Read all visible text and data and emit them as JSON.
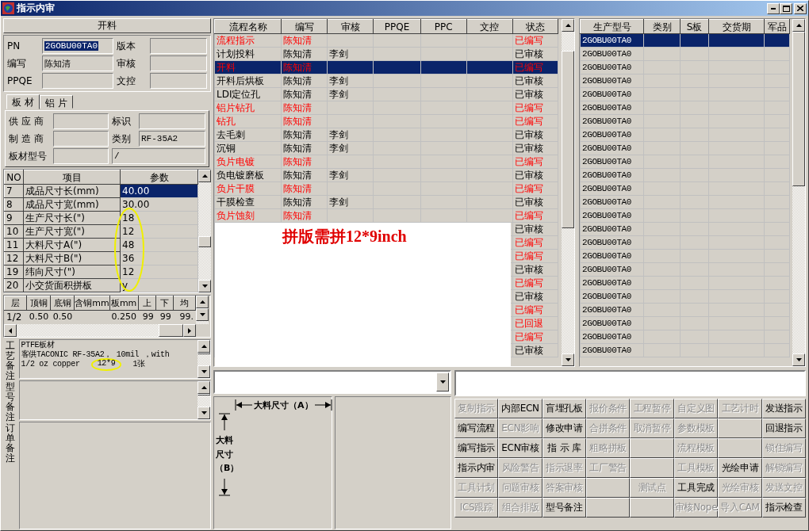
{
  "window": {
    "title": "指示内审"
  },
  "left_panel": {
    "header": "开料",
    "fields": [
      {
        "label": "PN",
        "value": "2GOBU00TA0",
        "highlighted": true
      },
      {
        "label": "版本"
      },
      {
        "label": "编写",
        "value": "陈知清",
        "highlighted": false
      },
      {
        "label": "审核"
      },
      {
        "label": "PPQE"
      },
      {
        "label": "文控"
      }
    ],
    "tabs": [
      {
        "label": "板 材",
        "selected": true
      },
      {
        "label": "铝 片",
        "selected": false
      }
    ],
    "material_fields": [
      {
        "label": "供 应 商"
      },
      {
        "label": "标识"
      },
      {
        "label": "制 造 商"
      },
      {
        "label": "类别",
        "value": "RF-35A2"
      },
      {
        "label": "板材型号"
      },
      {
        "value": "/"
      }
    ],
    "params": {
      "columns": [
        "NO",
        "项目",
        "参数"
      ],
      "rows": [
        {
          "no": "7",
          "item": "成品尺寸长(mm)",
          "value": "40.00",
          "selected": true
        },
        {
          "no": "8",
          "item": "成品尺寸宽(mm)",
          "value": "30.00",
          "selected": false
        },
        {
          "no": "9",
          "item": "生产尺寸长(\")",
          "value": "18",
          "selected": false
        },
        {
          "no": "10",
          "item": "生产尺寸宽(\")",
          "value": "12",
          "selected": false
        },
        {
          "no": "11",
          "item": "大料尺寸A(\")",
          "value": "48",
          "selected": false
        },
        {
          "no": "12",
          "item": "大料尺寸B(\")",
          "value": "36",
          "selected": false
        },
        {
          "no": "19",
          "item": "纬向尺寸(\")",
          "value": "12",
          "selected": false
        },
        {
          "no": "20",
          "item": "小交货面积拼板",
          "value": "y",
          "selected": false
        }
      ]
    },
    "layers": {
      "columns": [
        "层",
        "顶铜",
        "底铜",
        "含铜mm",
        "板mm",
        "上",
        "下",
        "均"
      ],
      "rows": [
        [
          "1/2",
          "0.50",
          "0.50",
          null,
          "0.250",
          "99",
          "99",
          "99."
        ]
      ]
    },
    "notes": [
      {
        "label": "工艺备注",
        "lines": [
          {
            "parts": [
              {
                "text": "PTFE板材",
                "circled": false
              }
            ]
          },
          {
            "parts": [
              {
                "text": "客供TACONIC RF-35A2， 10mil ，with",
                "circled": false
              }
            ]
          },
          {
            "parts": [
              {
                "text": "1/2 oz copper",
                "circled": false
              },
              {
                "text": "12*9",
                "circled": true
              },
              {
                "text": "1张",
                "circled": false
              }
            ]
          }
        ]
      },
      {
        "label": "型号备注"
      },
      {
        "label": "订单备注"
      }
    ]
  },
  "process_table": {
    "columns": [
      "流程名称",
      "编写",
      "审核",
      "PPQE",
      "PPC",
      "文控",
      "状态"
    ],
    "rows": [
      {
        "name": "流程指示",
        "writer": "陈知清",
        "status": "已编写",
        "flagged": true,
        "selected": false
      },
      {
        "name": "计划投料",
        "writer": "陈知清",
        "reviewer": "李剑",
        "status": "已审核",
        "flagged": false,
        "selected": false
      },
      {
        "name": "开料",
        "writer": "陈知清",
        "status": "已编写",
        "flagged": true,
        "selected": true
      },
      {
        "name": "开料后烘板",
        "writer": "陈知清",
        "reviewer": "李剑",
        "status": "已审核",
        "flagged": false,
        "selected": false
      },
      {
        "name": "LDI定位孔",
        "writer": "陈知清",
        "reviewer": "李剑",
        "status": "已审核",
        "flagged": false,
        "selected": false
      },
      {
        "name": "铝片钻孔",
        "writer": "陈知清",
        "status": "已编写",
        "flagged": true,
        "selected": false
      },
      {
        "name": "钻孔",
        "writer": "陈知清",
        "status": "已编写",
        "flagged": true,
        "selected": false
      },
      {
        "name": "去毛刺",
        "writer": "陈知清",
        "reviewer": "李剑",
        "status": "已审核",
        "flagged": false,
        "selected": false
      },
      {
        "name": "沉铜",
        "writer": "陈知清",
        "reviewer": "李剑",
        "status": "已审核",
        "flagged": false,
        "selected": false
      },
      {
        "name": "负片电镀",
        "writer": "陈知清",
        "status": "已编写",
        "flagged": true,
        "selected": false
      },
      {
        "name": "负电镀磨板",
        "writer": "陈知清",
        "reviewer": "李剑",
        "status": "已审核",
        "flagged": false,
        "selected": false
      },
      {
        "name": "负片干膜",
        "writer": "陈知清",
        "status": "已编写",
        "flagged": true,
        "selected": false
      },
      {
        "name": "干膜检查",
        "writer": "陈知清",
        "reviewer": "李剑",
        "status": "已审核",
        "flagged": false,
        "selected": false
      },
      {
        "name": "负片蚀刻",
        "writer": "陈知清",
        "status": "已编写",
        "flagged": true,
        "selected": false
      },
      {
        "status": "已审核",
        "flagged": false,
        "selected": false
      },
      {
        "status": "已编写",
        "flagged": true,
        "selected": false
      },
      {
        "status": "已编写",
        "flagged": true,
        "selected": false
      },
      {
        "status": "已审核",
        "flagged": false,
        "selected": false
      },
      {
        "status": "已编写",
        "flagged": true,
        "selected": false
      },
      {
        "status": "已审核",
        "flagged": false,
        "selected": false
      },
      {
        "status": "已编写",
        "flagged": true,
        "selected": false
      },
      {
        "status": "已回退",
        "flagged": true,
        "selected": false
      },
      {
        "status": "已编写",
        "flagged": true,
        "selected": false
      },
      {
        "status": "已审核",
        "flagged": false,
        "selected": false
      }
    ]
  },
  "overlay_note": "拼版需拼12*9inch",
  "model_table": {
    "columns": [
      "生产型号",
      "类别",
      "S板",
      "交货期",
      "军品"
    ],
    "rows": [
      {
        "model": "2GOBU00TA0",
        "selected": true
      },
      {
        "model": "2GOBU00TA0",
        "selected": false
      },
      {
        "model": "2GOBU00TA0",
        "selected": false
      },
      {
        "model": "2GOBU00TA0",
        "selected": false
      },
      {
        "model": "2GOBU00TA0",
        "selected": false
      },
      {
        "model": "2GOBU00TA0",
        "selected": false
      },
      {
        "model": "2GOBU00TA0",
        "selected": false
      },
      {
        "model": "2GOBU00TA0",
        "selected": false
      },
      {
        "model": "2GOBU00TA0",
        "selected": false
      },
      {
        "model": "2GOBU00TA0",
        "selected": false
      },
      {
        "model": "2GOBU00TA0",
        "selected": false
      },
      {
        "model": "2GOBU00TA0",
        "selected": false
      },
      {
        "model": "2GOBU00TA0",
        "selected": false
      },
      {
        "model": "2GOBU00TA0",
        "selected": false
      },
      {
        "model": "2GOBU00TA0",
        "selected": false
      },
      {
        "model": "2GOBU00TA0",
        "selected": false
      },
      {
        "model": "2GOBU00TA0",
        "selected": false
      },
      {
        "model": "2GOBU00TA0",
        "selected": false
      },
      {
        "model": "2GOBU00TA0",
        "selected": false
      },
      {
        "model": "2GOBU00TA0",
        "selected": false
      },
      {
        "model": "2GOBU00TA0",
        "selected": false
      },
      {
        "model": "2GOBU00TA0",
        "selected": false
      },
      {
        "model": "2GOBU00TA0",
        "selected": false
      },
      {
        "model": "2GOBU00TA0",
        "selected": false
      }
    ]
  },
  "diagram": {
    "label_a": "大料尺寸（A）",
    "label_b": "大料尺寸（B）"
  },
  "buttons": [
    {
      "kind": "action",
      "label": "复制指示",
      "disabled": true
    },
    {
      "kind": "action",
      "label": "内部ECN",
      "disabled": false
    },
    {
      "kind": "action",
      "label": "盲埋孔板",
      "disabled": false
    },
    {
      "kind": "action",
      "label": "报价条件",
      "disabled": true
    },
    {
      "kind": "action",
      "label": "工程暂停",
      "disabled": true
    },
    {
      "kind": "action",
      "label": "自定义图",
      "disabled": true
    },
    {
      "kind": "action",
      "label": "工艺计时",
      "disabled": true
    },
    {
      "kind": "action",
      "label": "发送指示",
      "disabled": false
    },
    {
      "kind": "action",
      "label": "编写流程",
      "disabled": false
    },
    {
      "kind": "action",
      "label": "ECN影响",
      "disabled": true
    },
    {
      "kind": "action",
      "label": "修改申请",
      "disabled": false
    },
    {
      "kind": "action",
      "label": "合拼条件",
      "disabled": true
    },
    {
      "kind": "action",
      "label": "取消暂停",
      "disabled": true
    },
    {
      "kind": "action",
      "label": "参数模板",
      "disabled": true
    },
    {
      "kind": "blank"
    },
    {
      "kind": "action",
      "label": "回退指示",
      "disabled": false
    },
    {
      "kind": "action",
      "label": "编写指示",
      "disabled": false
    },
    {
      "kind": "action",
      "label": "ECN审核",
      "disabled": false
    },
    {
      "kind": "action",
      "label": "指 示 库",
      "disabled": false
    },
    {
      "kind": "action",
      "label": "粗略拼板",
      "disabled": true
    },
    {
      "kind": "blank"
    },
    {
      "kind": "action",
      "label": "流程模板",
      "disabled": true
    },
    {
      "kind": "blank"
    },
    {
      "kind": "action",
      "label": "锁住编写",
      "disabled": true
    },
    {
      "kind": "action",
      "label": "指示内审",
      "disabled": false
    },
    {
      "kind": "action",
      "label": "风险警告",
      "disabled": true
    },
    {
      "kind": "action",
      "label": "指示退率",
      "disabled": true
    },
    {
      "kind": "action",
      "label": "工厂警告",
      "disabled": true
    },
    {
      "kind": "blank"
    },
    {
      "kind": "action",
      "label": "工具模板",
      "disabled": true
    },
    {
      "kind": "action",
      "label": "光绘申请",
      "disabled": false
    },
    {
      "kind": "action",
      "label": "解锁编写",
      "disabled": true
    },
    {
      "kind": "action",
      "label": "工具计划",
      "disabled": true
    },
    {
      "kind": "action",
      "label": "问题审核",
      "disabled": true
    },
    {
      "kind": "action",
      "label": "答案审核",
      "disabled": true
    },
    {
      "kind": "blank"
    },
    {
      "kind": "action",
      "label": "测试点",
      "disabled": true
    },
    {
      "kind": "action",
      "label": "工具完成",
      "disabled": false
    },
    {
      "kind": "action",
      "label": "光绘审核",
      "disabled": true
    },
    {
      "kind": "action",
      "label": "发送文控",
      "disabled": true
    },
    {
      "kind": "action",
      "label": "ICS跟踪",
      "disabled": true
    },
    {
      "kind": "action",
      "label": "组合排版",
      "disabled": true
    },
    {
      "kind": "action",
      "label": "型号备注",
      "disabled": false
    },
    {
      "kind": "blank"
    },
    {
      "kind": "blank"
    },
    {
      "kind": "action",
      "label": "审核Nope",
      "disabled": true
    },
    {
      "kind": "action",
      "label": "导入CAM",
      "disabled": true
    },
    {
      "kind": "action",
      "label": "指示检查",
      "disabled": false
    }
  ]
}
